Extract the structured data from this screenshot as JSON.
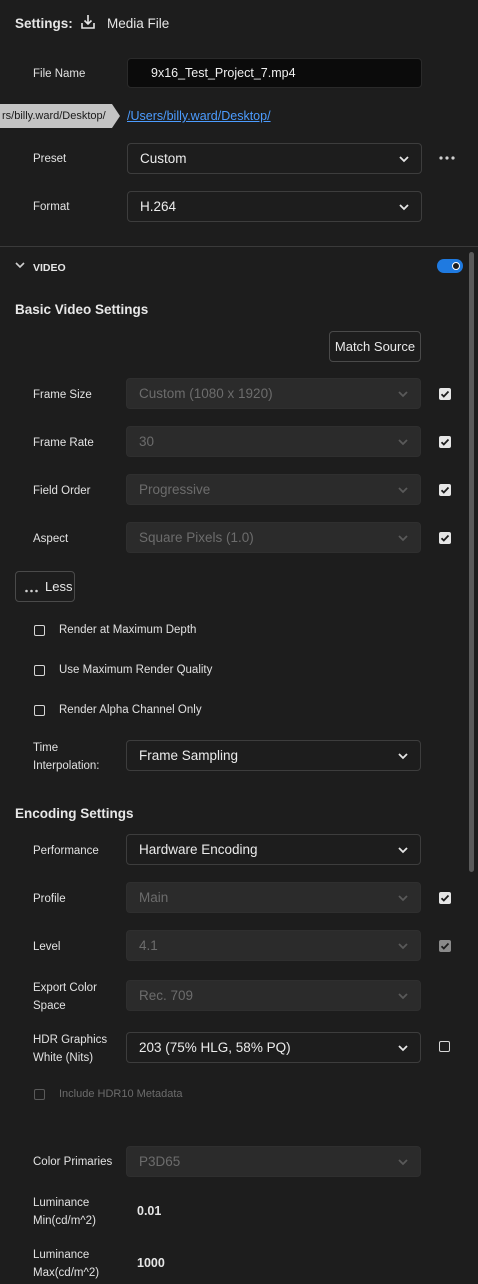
{
  "header": {
    "settings_label": "Settings:",
    "media_file_label": "Media File"
  },
  "file": {
    "name_label": "File Name",
    "name_value": "9x16_Test_Project_7.mp4",
    "location_tooltip": "rs/billy.ward/Desktop/",
    "location_link": "/Users/billy.ward/Desktop/",
    "preset_label": "Preset",
    "preset_value": "Custom",
    "format_label": "Format",
    "format_value": "H.264"
  },
  "video": {
    "section_label": "VIDEO",
    "toggle_on": true,
    "basic_title": "Basic Video Settings",
    "match_source": "Match Source",
    "frame_size_label": "Frame Size",
    "frame_size_value": "Custom (1080 x 1920)",
    "frame_rate_label": "Frame Rate",
    "frame_rate_value": "30",
    "field_order_label": "Field Order",
    "field_order_value": "Progressive",
    "aspect_label": "Aspect",
    "aspect_value": "Square Pixels (1.0)",
    "less_button": "Less",
    "render_max_depth": "Render at Maximum Depth",
    "use_max_quality": "Use Maximum Render Quality",
    "render_alpha": "Render Alpha Channel Only",
    "time_interp_label_1": "Time",
    "time_interp_label_2": "Interpolation:",
    "time_interp_value": "Frame Sampling"
  },
  "encoding": {
    "title": "Encoding Settings",
    "performance_label": "Performance",
    "performance_value": "Hardware Encoding",
    "profile_label": "Profile",
    "profile_value": "Main",
    "level_label": "Level",
    "level_value": "4.1",
    "color_space_label_1": "Export Color",
    "color_space_label_2": "Space",
    "color_space_value": "Rec. 709",
    "hdr_white_label_1": "HDR Graphics",
    "hdr_white_label_2": "White (Nits)",
    "hdr_white_value": "203 (75% HLG, 58% PQ)",
    "include_hdr10": "Include HDR10 Metadata",
    "color_primaries_label": "Color Primaries",
    "color_primaries_value": "P3D65",
    "lum_min_label_1": "Luminance",
    "lum_min_label_2": "Min(cd/m^2)",
    "lum_min_value": "0.01",
    "lum_max_label_1": "Luminance",
    "lum_max_label_2": "Max(cd/m^2)",
    "lum_max_value": "1000"
  },
  "colors": {
    "accent": "#1f7ae0",
    "background": "#1d1d1d",
    "disabled_field": "#2b2b2b"
  }
}
